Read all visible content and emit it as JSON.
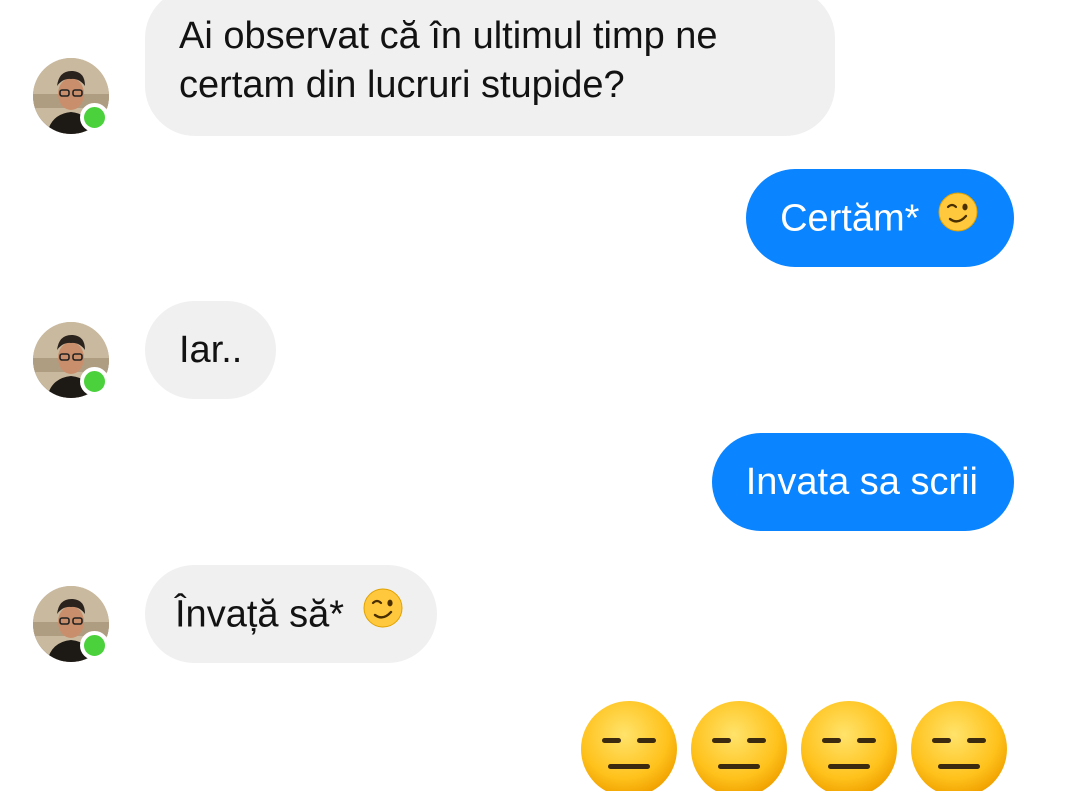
{
  "messages": [
    {
      "id": "m1",
      "direction": "incoming",
      "lines": [
        "Ai observat că în ultimul timp ne",
        "certam din lucruri stupide?"
      ]
    },
    {
      "id": "m2",
      "direction": "outgoing",
      "text": "Certăm*",
      "emoji": "winking-face"
    },
    {
      "id": "m3",
      "direction": "incoming",
      "text": "Iar.."
    },
    {
      "id": "m4",
      "direction": "outgoing",
      "text": "Invata sa scrii"
    },
    {
      "id": "m5",
      "direction": "incoming",
      "text": "Învață să*",
      "emoji": "winking-face"
    },
    {
      "id": "m6",
      "direction": "outgoing",
      "emoji": "expressionless-face",
      "emoji_count": 4
    }
  ],
  "contact": {
    "presence": "online",
    "avatar": "profile-photo"
  },
  "colors": {
    "incoming_bubble": "#f1f0f0",
    "outgoing_bubble": "#0a84ff",
    "online_dot": "#4ad13c"
  }
}
